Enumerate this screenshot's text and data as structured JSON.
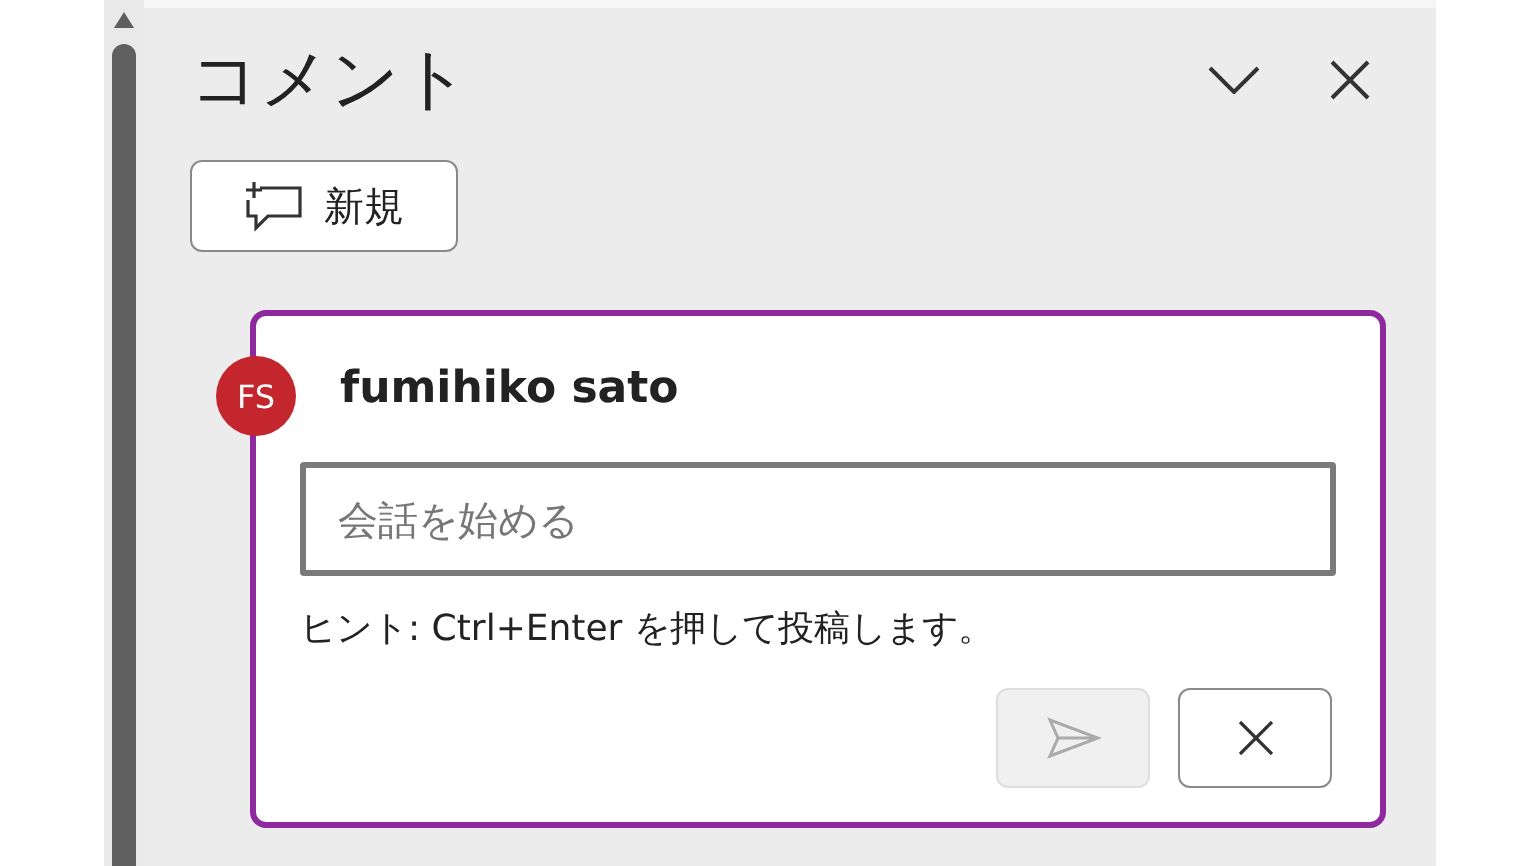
{
  "panel": {
    "title": "コメント"
  },
  "new_button": {
    "label": "新規"
  },
  "comment_draft": {
    "avatar": "FS",
    "author": "fumihiko sato",
    "input": {
      "placeholder": "会話を始める"
    },
    "hint": "ヒント: Ctrl+Enter を押して投稿します。",
    "send_disabled": true
  }
}
